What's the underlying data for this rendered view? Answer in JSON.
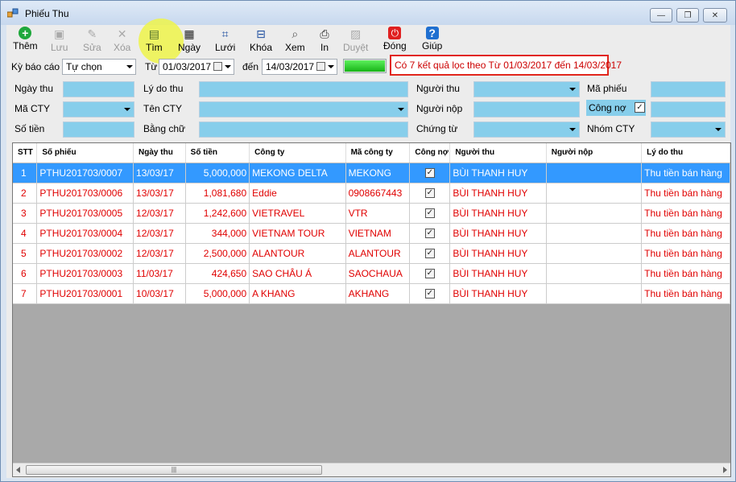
{
  "window": {
    "title": "Phiếu Thu",
    "min": "—",
    "max": "❐",
    "close": "✕"
  },
  "toolbar": {
    "buttons": [
      {
        "label": "Thêm",
        "icon": "add-icon",
        "glyph": "+",
        "color": "#1fa83c",
        "disabled": false
      },
      {
        "label": "Lưu",
        "icon": "save-icon",
        "glyph": "▣",
        "color": "#aaaaaa",
        "disabled": true
      },
      {
        "label": "Sửa",
        "icon": "edit-icon",
        "glyph": "✎",
        "color": "#aaaaaa",
        "disabled": true
      },
      {
        "label": "Xóa",
        "icon": "delete-icon",
        "glyph": "✕",
        "color": "#aaaaaa",
        "disabled": true
      },
      {
        "label": "Tìm",
        "icon": "find-icon",
        "glyph": "▤",
        "color": "#4d6b2a",
        "disabled": false
      },
      {
        "label": "Ngày",
        "icon": "calendar-icon",
        "glyph": "▦",
        "color": "#222222",
        "disabled": false
      },
      {
        "label": "Lưới",
        "icon": "grid-icon",
        "glyph": "⌗",
        "color": "#1f4fa0",
        "disabled": false
      },
      {
        "label": "Khóa",
        "icon": "lock-icon",
        "glyph": "⊟",
        "color": "#1f4fa0",
        "disabled": false
      },
      {
        "label": "Xem",
        "icon": "preview-icon",
        "glyph": "⌕",
        "color": "#555555",
        "disabled": false
      },
      {
        "label": "In",
        "icon": "print-icon",
        "glyph": "⎙",
        "color": "#222222",
        "disabled": false
      },
      {
        "label": "Duyệt",
        "icon": "approve-icon",
        "glyph": "▨",
        "color": "#aaaaaa",
        "disabled": true
      },
      {
        "label": "Đóng",
        "icon": "power-icon",
        "glyph": "⏻",
        "color": "#e02020",
        "disabled": false
      },
      {
        "label": "Giúp",
        "icon": "help-icon",
        "glyph": "?",
        "color": "#1f6fd0",
        "disabled": false
      }
    ]
  },
  "filter": {
    "report_period_label": "Kỳ báo cáo",
    "report_period_value": "Tự chọn",
    "from_label": "Từ",
    "from_date": "01/03/2017",
    "to_label": "đến",
    "to_date": "14/03/2017",
    "progress": 1.0,
    "result_text": "Có 7 kết quả lọc theo Từ 01/03/2017 đến 14/03/2017",
    "fields": {
      "ngay_thu": "Ngày thu",
      "ly_do_thu": "Lý do thu",
      "nguoi_thu": "Người thu",
      "ma_phieu": "Mã phiếu",
      "ma_cty": "Mã CTY",
      "ten_cty": "Tên CTY",
      "nguoi_nop": "Người nộp",
      "cong_no": "Công nợ",
      "so_tien": "Số tiền",
      "bang_chu": "Bằng chữ",
      "chung_tu": "Chứng từ",
      "nhom_cty": "Nhóm CTY"
    },
    "cong_no_checked": "✓"
  },
  "grid": {
    "columns": [
      "STT",
      "Số phiếu",
      "Ngày thu",
      "Số tiền",
      "Công ty",
      "Mã công ty",
      "Công nợ",
      "Người thu",
      "Người nộp",
      "Lý do thu"
    ],
    "rows": [
      {
        "stt": "1",
        "so_phieu": "PTHU201703/0007",
        "ngay_thu": "13/03/17",
        "so_tien": "5,000,000",
        "cong_ty": "MEKONG DELTA",
        "ma_cong_ty": "MEKONG",
        "cong_no": "✓",
        "nguoi_thu": "BÙI THANH HUY",
        "nguoi_nop": "",
        "ly_do_thu": "Thu tiền bán hàng",
        "selected": true
      },
      {
        "stt": "2",
        "so_phieu": "PTHU201703/0006",
        "ngay_thu": "13/03/17",
        "so_tien": "1,081,680",
        "cong_ty": "Eddie",
        "ma_cong_ty": "0908667443",
        "cong_no": "✓",
        "nguoi_thu": "BÙI THANH HUY",
        "nguoi_nop": "",
        "ly_do_thu": "Thu tiền bán hàng",
        "selected": false
      },
      {
        "stt": "3",
        "so_phieu": "PTHU201703/0005",
        "ngay_thu": "12/03/17",
        "so_tien": "1,242,600",
        "cong_ty": "VIETRAVEL",
        "ma_cong_ty": "VTR",
        "cong_no": "✓",
        "nguoi_thu": "BÙI THANH HUY",
        "nguoi_nop": "",
        "ly_do_thu": "Thu tiền bán hàng",
        "selected": false
      },
      {
        "stt": "4",
        "so_phieu": "PTHU201703/0004",
        "ngay_thu": "12/03/17",
        "so_tien": "344,000",
        "cong_ty": "VIETNAM TOUR",
        "ma_cong_ty": "VIETNAM",
        "cong_no": "✓",
        "nguoi_thu": "BÙI THANH HUY",
        "nguoi_nop": "",
        "ly_do_thu": "Thu tiền bán hàng",
        "selected": false
      },
      {
        "stt": "5",
        "so_phieu": "PTHU201703/0002",
        "ngay_thu": "12/03/17",
        "so_tien": "2,500,000",
        "cong_ty": "ALANTOUR",
        "ma_cong_ty": "ALANTOUR",
        "cong_no": "✓",
        "nguoi_thu": "BÙI THANH HUY",
        "nguoi_nop": "",
        "ly_do_thu": "Thu tiền bán hàng",
        "selected": false
      },
      {
        "stt": "6",
        "so_phieu": "PTHU201703/0003",
        "ngay_thu": "11/03/17",
        "so_tien": "424,650",
        "cong_ty": "SAO CHÂU Á",
        "ma_cong_ty": "SAOCHAUA",
        "cong_no": "✓",
        "nguoi_thu": "BÙI THANH HUY",
        "nguoi_nop": "",
        "ly_do_thu": "Thu tiền bán hàng",
        "selected": false
      },
      {
        "stt": "7",
        "so_phieu": "PTHU201703/0001",
        "ngay_thu": "10/03/17",
        "so_tien": "5,000,000",
        "cong_ty": "A KHANG",
        "ma_cong_ty": "AKHANG",
        "cong_no": "✓",
        "nguoi_thu": "BÙI THANH HUY",
        "nguoi_nop": "",
        "ly_do_thu": "Thu tiền bán hàng",
        "selected": false
      }
    ],
    "scroll_thumb_grip": "|||"
  },
  "colors": {
    "field_bg": "#87ceeb",
    "row_text": "#e00000",
    "selected_row": "#3399ff",
    "result_border": "#e1261c"
  }
}
